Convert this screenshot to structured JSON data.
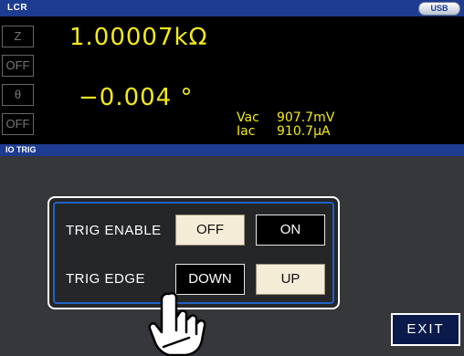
{
  "window": {
    "title": "LCR",
    "usb_badge": "USB"
  },
  "measure": {
    "param1": "Z",
    "param1_range": "OFF",
    "param1_value": "1.00007kΩ",
    "param2": "θ",
    "param2_range": "OFF",
    "param2_value": "−0.004 °",
    "vac_label": "Vac",
    "vac_value": "907.7mV",
    "iac_label": "Iac",
    "iac_value": "910.7μA"
  },
  "section": {
    "title": "IO TRIG"
  },
  "trig": {
    "enable_label": "TRIG ENABLE",
    "enable_off": "OFF",
    "enable_on": "ON",
    "edge_label": "TRIG EDGE",
    "edge_down": "DOWN",
    "edge_up": "UP"
  },
  "exit_label": "EXIT",
  "colors": {
    "title_bar": "#1e3c8f",
    "value_text": "#f2ea1a",
    "panel_border": "#1f63c4",
    "selected_button": "#000000",
    "unselected_button": "#f4ecd6"
  }
}
